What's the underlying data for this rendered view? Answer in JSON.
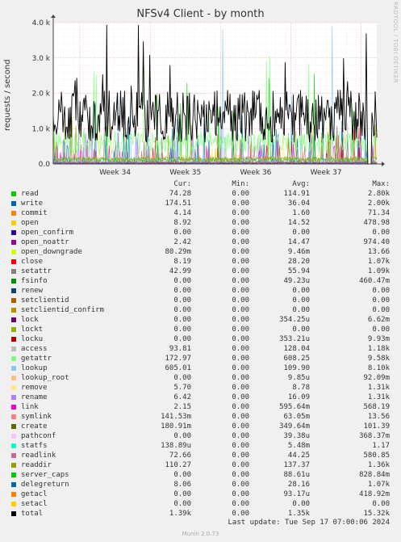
{
  "chart_data": {
    "type": "line",
    "title": "NFSv4 Client - by month",
    "ylabel": "requests / second",
    "rrdtool_label": "RRDTOOL / TOBI OETIKER",
    "ylim": [
      0,
      4000
    ],
    "yticks": [
      {
        "value": 0,
        "label": "0.0"
      },
      {
        "value": 1000,
        "label": "1.0 k"
      },
      {
        "value": 2000,
        "label": "2.0 k"
      },
      {
        "value": 3000,
        "label": "3.0 k"
      },
      {
        "value": 4000,
        "label": "4.0 k"
      }
    ],
    "xticks": [
      "Week 34",
      "Week 35",
      "Week 36",
      "Week 37"
    ],
    "grid": true,
    "columns": [
      "Cur:",
      "Min:",
      "Avg:",
      "Max:"
    ],
    "series": [
      {
        "name": "read",
        "color": "#00cc00",
        "cur": "74.28",
        "min": "0.00",
        "avg": "114.91",
        "max": "2.80k"
      },
      {
        "name": "write",
        "color": "#0066b3",
        "cur": "174.51",
        "min": "0.00",
        "avg": "36.04",
        "max": "2.00k"
      },
      {
        "name": "commit",
        "color": "#ff8000",
        "cur": "4.14",
        "min": "0.00",
        "avg": "1.60",
        "max": "71.34"
      },
      {
        "name": "open",
        "color": "#ffcc00",
        "cur": "8.92",
        "min": "0.00",
        "avg": "14.52",
        "max": "478.98"
      },
      {
        "name": "open_confirm",
        "color": "#330099",
        "cur": "0.00",
        "min": "0.00",
        "avg": "0.00",
        "max": "0.00"
      },
      {
        "name": "open_noattr",
        "color": "#990099",
        "cur": "2.42",
        "min": "0.00",
        "avg": "14.47",
        "max": "974.40"
      },
      {
        "name": "open_downgrade",
        "color": "#ccff00",
        "cur": "80.29m",
        "min": "0.00",
        "avg": "9.46m",
        "max": "13.66"
      },
      {
        "name": "close",
        "color": "#ff0000",
        "cur": "8.19",
        "min": "0.00",
        "avg": "28.20",
        "max": "1.07k"
      },
      {
        "name": "setattr",
        "color": "#808080",
        "cur": "42.99",
        "min": "0.00",
        "avg": "55.94",
        "max": "1.09k"
      },
      {
        "name": "fsinfo",
        "color": "#008f00",
        "cur": "0.00",
        "min": "0.00",
        "avg": "49.23u",
        "max": "460.47m"
      },
      {
        "name": "renew",
        "color": "#00487d",
        "cur": "0.00",
        "min": "0.00",
        "avg": "0.00",
        "max": "0.00"
      },
      {
        "name": "setclientid",
        "color": "#b35a00",
        "cur": "0.00",
        "min": "0.00",
        "avg": "0.00",
        "max": "0.00"
      },
      {
        "name": "setclientid_confirm",
        "color": "#b38f00",
        "cur": "0.00",
        "min": "0.00",
        "avg": "0.00",
        "max": "0.00"
      },
      {
        "name": "lock",
        "color": "#6b006b",
        "cur": "0.00",
        "min": "0.00",
        "avg": "354.25u",
        "max": "6.62m"
      },
      {
        "name": "lockt",
        "color": "#8fb300",
        "cur": "0.00",
        "min": "0.00",
        "avg": "0.00",
        "max": "0.00"
      },
      {
        "name": "locku",
        "color": "#b30000",
        "cur": "0.00",
        "min": "0.00",
        "avg": "353.21u",
        "max": "9.93m"
      },
      {
        "name": "access",
        "color": "#bebebe",
        "cur": "93.81",
        "min": "0.00",
        "avg": "128.04",
        "max": "1.18k"
      },
      {
        "name": "getattr",
        "color": "#80ff80",
        "cur": "172.97",
        "min": "0.00",
        "avg": "608.25",
        "max": "9.58k"
      },
      {
        "name": "lookup",
        "color": "#80c9ff",
        "cur": "605.01",
        "min": "0.00",
        "avg": "109.90",
        "max": "8.10k"
      },
      {
        "name": "lookup_root",
        "color": "#ffc080",
        "cur": "0.00",
        "min": "0.00",
        "avg": "9.85u",
        "max": "92.09m"
      },
      {
        "name": "remove",
        "color": "#ffe680",
        "cur": "5.70",
        "min": "0.00",
        "avg": "8.78",
        "max": "1.31k"
      },
      {
        "name": "rename",
        "color": "#aa80ff",
        "cur": "6.42",
        "min": "0.00",
        "avg": "16.09",
        "max": "1.31k"
      },
      {
        "name": "link",
        "color": "#ee00cc",
        "cur": "2.15",
        "min": "0.00",
        "avg": "595.64m",
        "max": "568.19"
      },
      {
        "name": "symlink",
        "color": "#ff8080",
        "cur": "141.53m",
        "min": "0.00",
        "avg": "63.05m",
        "max": "13.56"
      },
      {
        "name": "create",
        "color": "#666600",
        "cur": "180.91m",
        "min": "0.00",
        "avg": "349.64m",
        "max": "101.39"
      },
      {
        "name": "pathconf",
        "color": "#ffbfff",
        "cur": "0.00",
        "min": "0.00",
        "avg": "39.38u",
        "max": "368.37m"
      },
      {
        "name": "statfs",
        "color": "#00ffcc",
        "cur": "138.89u",
        "min": "0.00",
        "avg": "5.48m",
        "max": "1.17"
      },
      {
        "name": "readlink",
        "color": "#cc6699",
        "cur": "72.66",
        "min": "0.00",
        "avg": "44.25",
        "max": "580.85"
      },
      {
        "name": "readdir",
        "color": "#999900",
        "cur": "110.27",
        "min": "0.00",
        "avg": "137.37",
        "max": "1.36k"
      },
      {
        "name": "server_caps",
        "color": "#00cc00",
        "cur": "0.00",
        "min": "0.00",
        "avg": "88.61u",
        "max": "828.84m"
      },
      {
        "name": "delegreturn",
        "color": "#0066b3",
        "cur": "8.06",
        "min": "0.00",
        "avg": "28.16",
        "max": "1.07k"
      },
      {
        "name": "getacl",
        "color": "#ff8000",
        "cur": "0.00",
        "min": "0.00",
        "avg": "93.17u",
        "max": "418.92m"
      },
      {
        "name": "setacl",
        "color": "#ffcc00",
        "cur": "0.00",
        "min": "0.00",
        "avg": "0.00",
        "max": "0.00"
      },
      {
        "name": "total",
        "color": "#000000",
        "cur": "1.39k",
        "min": "0.00",
        "avg": "1.35k",
        "max": "15.32k"
      }
    ]
  },
  "last_update": "Last update: Tue Sep 17 07:00:06 2024",
  "munin_version": "Munin 2.0.73"
}
